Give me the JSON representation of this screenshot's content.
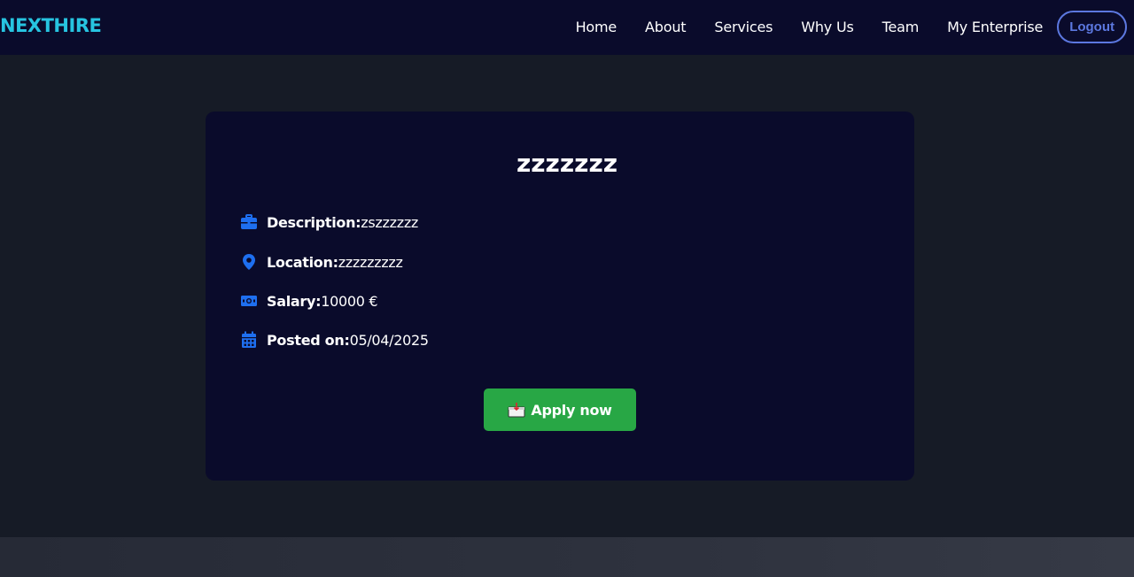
{
  "header": {
    "brand": "NEXTHIRE",
    "nav": [
      "Home",
      "About",
      "Services",
      "Why Us",
      "Team",
      "My Enterprise"
    ],
    "logout_label": "Logout"
  },
  "job": {
    "title": "zzzzzzz",
    "description_label": "Description:",
    "description_value": "zszzzzzz",
    "location_label": "Location:",
    "location_value": "zzzzzzzzz",
    "salary_label": "Salary:",
    "salary_value": "10000 €",
    "posted_label": "Posted on:",
    "posted_value": "05/04/2025",
    "apply_label": "Apply now"
  },
  "colors": {
    "brand": "#27c4e0",
    "nav_bg": "#0a0b2b",
    "page_bg": "#161b26",
    "card_bg": "#0a0b2b",
    "icon": "#1e6ff0",
    "apply": "#28a745",
    "logout": "#5c78e0"
  },
  "icons": {
    "description": "briefcase-icon",
    "location": "map-pin-icon",
    "salary": "money-bill-icon",
    "posted": "calendar-icon",
    "apply": "inbox-tray-icon"
  }
}
